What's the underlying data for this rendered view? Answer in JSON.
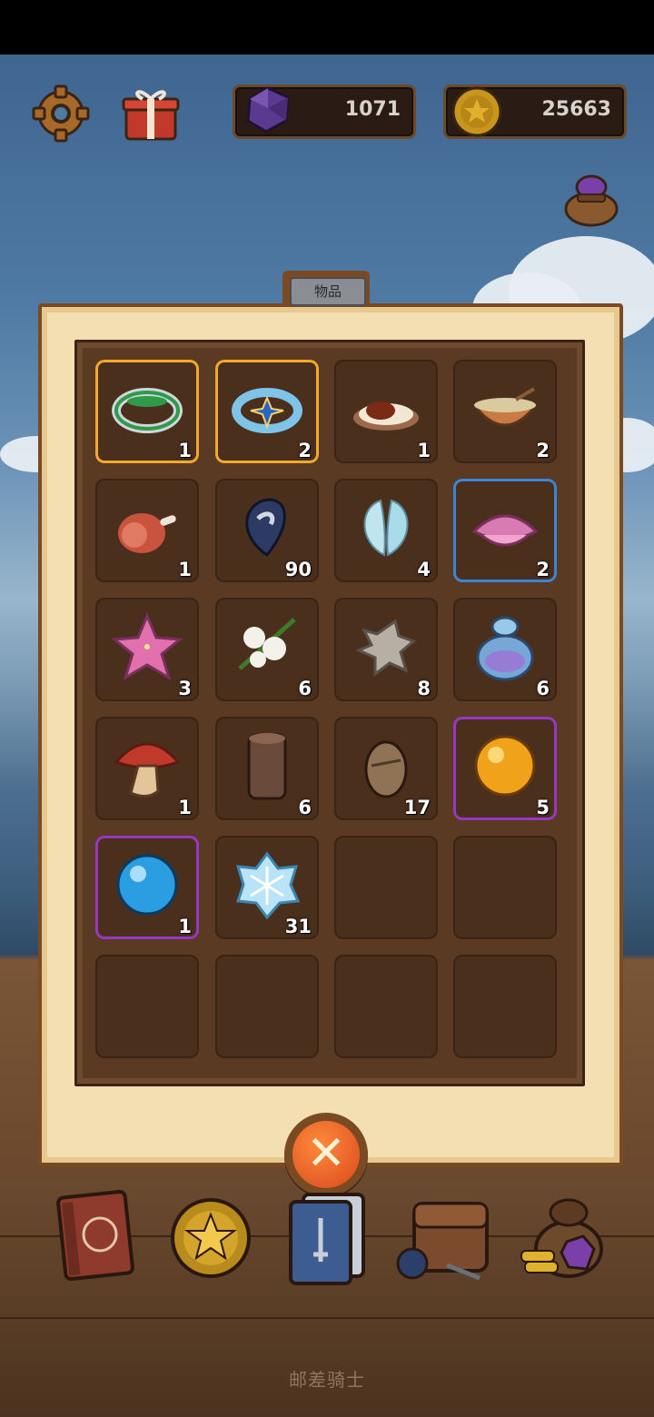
{
  "hud": {
    "settings_icon": "gear-icon",
    "gift_icon": "gift-icon",
    "gems": "1071",
    "coins": "25663",
    "bag_icon": "gem-bag-icon"
  },
  "panel": {
    "title": "物品",
    "close_icon": "close-icon"
  },
  "inventory": [
    {
      "icon": "green-ring",
      "count": "1",
      "border": "gold"
    },
    {
      "icon": "star-ring",
      "count": "2",
      "border": "gold"
    },
    {
      "icon": "curry-rice",
      "count": "1",
      "border": "none"
    },
    {
      "icon": "soup-bowl",
      "count": "2",
      "border": "none"
    },
    {
      "icon": "ham-meat",
      "count": "1",
      "border": "none"
    },
    {
      "icon": "dark-feather",
      "count": "90",
      "border": "none"
    },
    {
      "icon": "angel-wings",
      "count": "4",
      "border": "none"
    },
    {
      "icon": "pink-clam",
      "count": "2",
      "border": "blue"
    },
    {
      "icon": "pink-starfish",
      "count": "3",
      "border": "none"
    },
    {
      "icon": "cotton-flower",
      "count": "6",
      "border": "none"
    },
    {
      "icon": "animal-pelt",
      "count": "8",
      "border": "none"
    },
    {
      "icon": "potion-sack",
      "count": "6",
      "border": "none"
    },
    {
      "icon": "red-mushroom",
      "count": "1",
      "border": "none"
    },
    {
      "icon": "wood-log",
      "count": "6",
      "border": "none"
    },
    {
      "icon": "egg-stone",
      "count": "17",
      "border": "none"
    },
    {
      "icon": "orange-orb",
      "count": "5",
      "border": "purple"
    },
    {
      "icon": "blue-orb",
      "count": "1",
      "border": "purple"
    },
    {
      "icon": "snowflake",
      "count": "31",
      "border": "none"
    },
    {
      "icon": "",
      "count": "",
      "border": "none"
    },
    {
      "icon": "",
      "count": "",
      "border": "none"
    },
    {
      "icon": "",
      "count": "",
      "border": "none"
    },
    {
      "icon": "",
      "count": "",
      "border": "none"
    },
    {
      "icon": "",
      "count": "",
      "border": "none"
    },
    {
      "icon": "",
      "count": "",
      "border": "none"
    }
  ],
  "nav": [
    {
      "icon": "red-book-icon"
    },
    {
      "icon": "star-coin-icon"
    },
    {
      "icon": "card-deck-icon"
    },
    {
      "icon": "backpack-icon"
    },
    {
      "icon": "treasure-bag-icon"
    }
  ],
  "footer": {
    "label": "邮差骑士"
  }
}
